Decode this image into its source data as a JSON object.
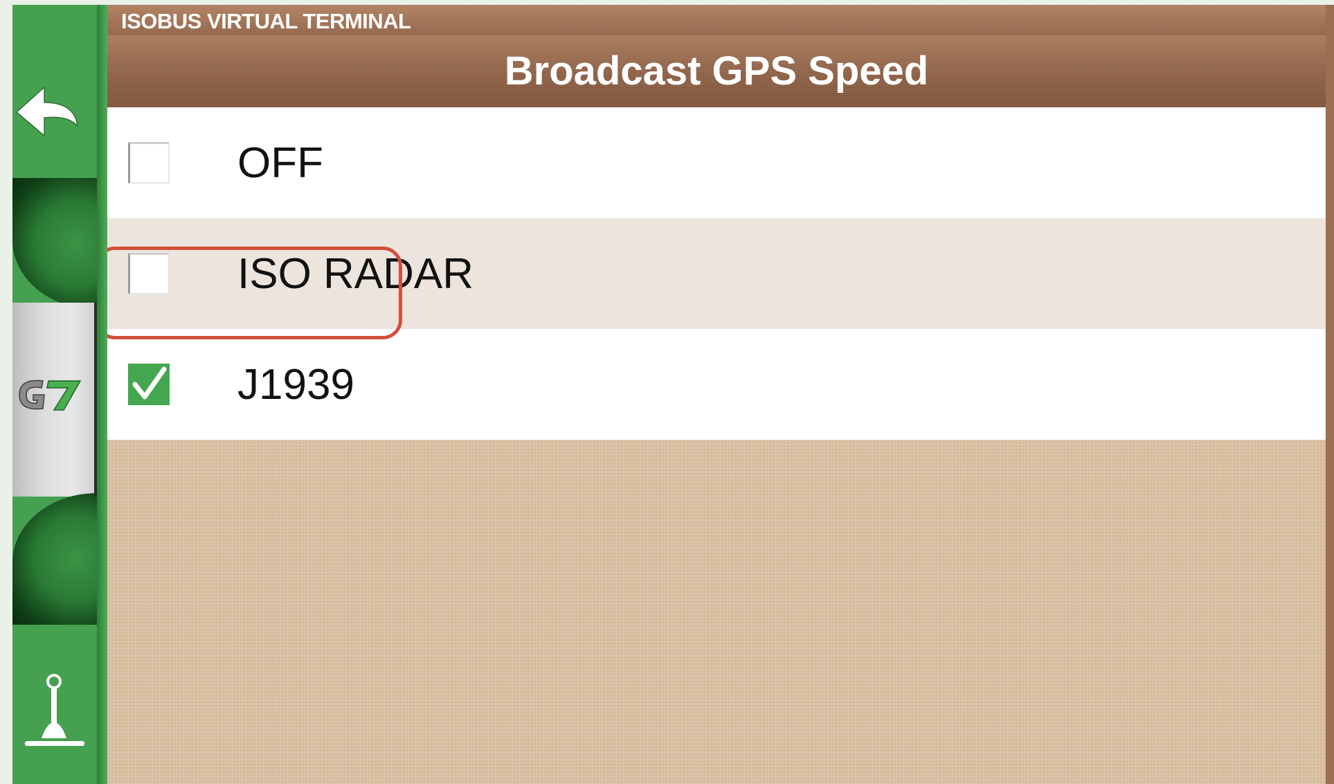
{
  "app_bar": {
    "title": "ISOBUS VIRTUAL TERMINAL"
  },
  "header": {
    "title": "Broadcast GPS Speed"
  },
  "sidebar": {
    "back_icon": "back-arrow-icon",
    "logo": "G7",
    "joystick_icon": "joystick-icon"
  },
  "options": [
    {
      "label": "OFF",
      "checked": false
    },
    {
      "label": "ISO RADAR",
      "checked": false
    },
    {
      "label": "J1939",
      "checked": true
    }
  ],
  "highlight": {
    "target": "J1939",
    "color": "#d2503b"
  },
  "colors": {
    "sidebar_green": "#45a04f",
    "header_brown": "#8b5f45",
    "background_tan": "#d6bb9c",
    "check_green": "#44a64f"
  }
}
